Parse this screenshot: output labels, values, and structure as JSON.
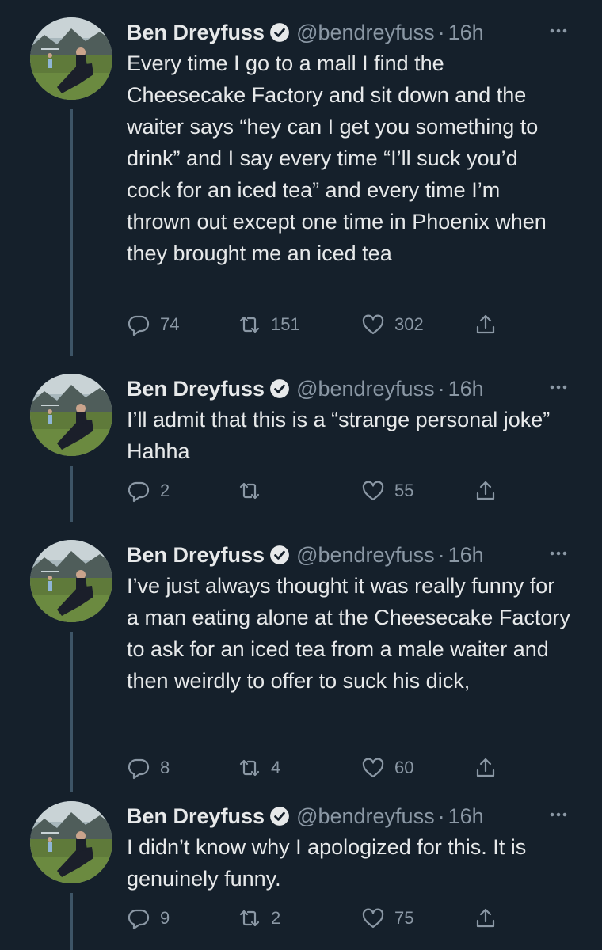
{
  "tweets": [
    {
      "name": "Ben Dreyfuss",
      "handle": "@bendreyfuss",
      "time": "16h",
      "text": "Every time I go to a mall I find the Cheesecake Factory and sit down and the waiter says “hey can I get you something to drink” and I say every time “I’ll suck you’d cock for an iced tea” and every time I’m thrown out except one time in Phoenix when they brought me an iced tea",
      "replies": "74",
      "retweets": "151",
      "likes": "302"
    },
    {
      "name": "Ben Dreyfuss",
      "handle": "@bendreyfuss",
      "time": "16h",
      "text": "I’ll admit that this is a “strange personal joke” Hahha",
      "replies": "2",
      "retweets": "",
      "likes": "55"
    },
    {
      "name": "Ben Dreyfuss",
      "handle": "@bendreyfuss",
      "time": "16h",
      "text": "I’ve just always thought it was really funny for a man eating alone at the Cheesecake Factory to ask for an iced tea from a male waiter and then weirdly to offer to suck his dick,",
      "replies": "8",
      "retweets": "4",
      "likes": "60"
    },
    {
      "name": "Ben Dreyfuss",
      "handle": "@bendreyfuss",
      "time": "16h",
      "text": "I didn’t know why I apologized for this. It is genuinely funny.",
      "replies": "9",
      "retweets": "2",
      "likes": "75"
    }
  ],
  "separator": "·",
  "icons": {
    "verified": "verified-badge-icon",
    "more": "more-options-icon",
    "reply": "reply-icon",
    "retweet": "retweet-icon",
    "like": "heart-icon",
    "share": "share-icon"
  },
  "colors": {
    "background": "#15202b",
    "text": "#e7e9ea",
    "secondary": "#8b98a5",
    "thread_line": "#3d5466"
  }
}
